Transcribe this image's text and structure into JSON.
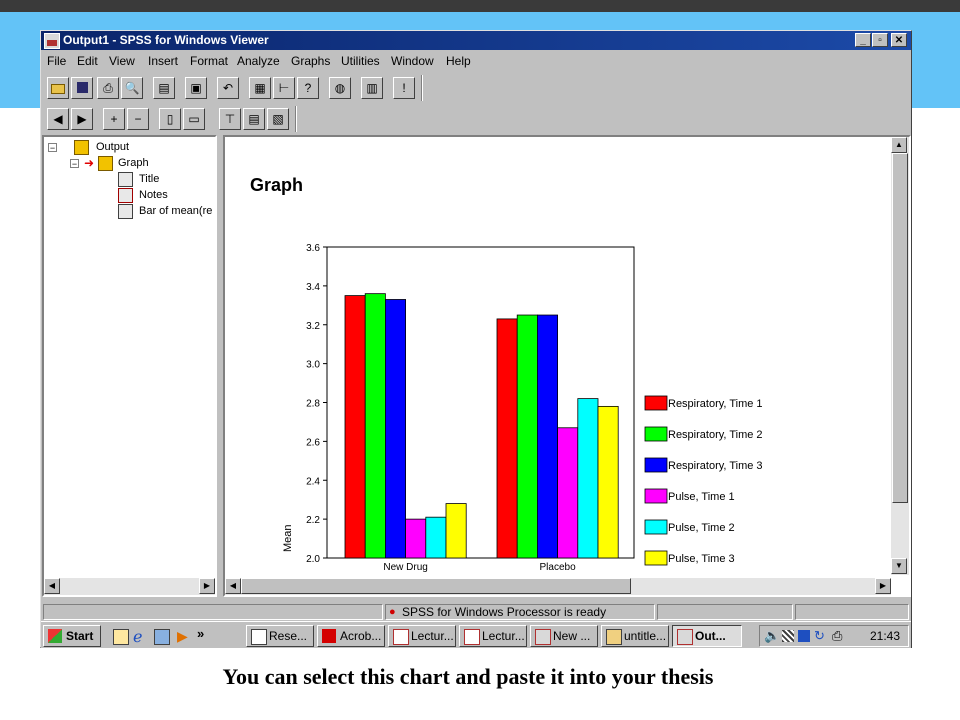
{
  "window": {
    "title": "Output1 - SPSS for Windows Viewer"
  },
  "menu": [
    "File",
    "Edit",
    "View",
    "Insert",
    "Format",
    "Analyze",
    "Graphs",
    "Utilities",
    "Window",
    "Help"
  ],
  "tree": {
    "root": "Output",
    "graph": "Graph",
    "children": [
      "Title",
      "Notes",
      "Bar of mean(re"
    ]
  },
  "content": {
    "heading": "Graph"
  },
  "chart_data": {
    "type": "bar",
    "categories": [
      "New Drug",
      "Placebo"
    ],
    "series": [
      {
        "name": "Respiratory, Time 1",
        "color": "#ff0000",
        "values": [
          3.35,
          3.23
        ]
      },
      {
        "name": "Respiratory, Time 2",
        "color": "#00ff00",
        "values": [
          3.36,
          3.25
        ]
      },
      {
        "name": "Respiratory, Time 3",
        "color": "#0000ff",
        "values": [
          3.33,
          3.25
        ]
      },
      {
        "name": "Pulse, Time 1",
        "color": "#ff00ff",
        "values": [
          2.2,
          2.67
        ]
      },
      {
        "name": "Pulse, Time 2",
        "color": "#00ffff",
        "values": [
          2.21,
          2.82
        ]
      },
      {
        "name": "Pulse, Time 3",
        "color": "#ffff00",
        "values": [
          2.28,
          2.78
        ]
      }
    ],
    "ylabel": "Mean",
    "ylim": [
      2.0,
      3.6
    ],
    "yticks": [
      "2.0",
      "2.2",
      "2.4",
      "2.6",
      "2.8",
      "3.0",
      "3.2",
      "3.4",
      "3.6"
    ],
    "legend": "right",
    "grid": false
  },
  "status": {
    "message": "SPSS for Windows Processor is ready"
  },
  "taskbar": {
    "start": "Start",
    "more": "»",
    "tasks": [
      "Rese...",
      "Acrob...",
      "Lectur...",
      "Lectur...",
      "New ...",
      "untitle...",
      "Out..."
    ],
    "clock": "21:43"
  },
  "caption": "You can select this chart and paste it into your thesis"
}
